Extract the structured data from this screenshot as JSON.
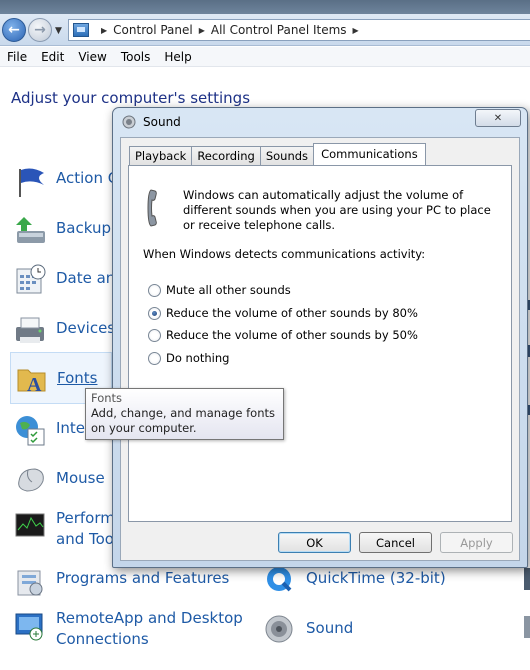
{
  "explorer": {
    "breadcrumb": [
      "Control Panel",
      "All Control Panel Items"
    ],
    "menu": [
      "File",
      "Edit",
      "View",
      "Tools",
      "Help"
    ],
    "heading": "Adjust your computer's settings",
    "items": [
      {
        "label": "Action C",
        "icon": "flag-icon"
      },
      {
        "label": "Backup a",
        "icon": "backup-icon"
      },
      {
        "label": "Date and",
        "icon": "calendar-clock-icon"
      },
      {
        "label": "Devices",
        "icon": "printer-icon"
      },
      {
        "label": "Fonts",
        "icon": "fonts-folder-icon"
      },
      {
        "label": "Inte",
        "icon": "globe-icon"
      },
      {
        "label": "Mouse",
        "icon": "mouse-icon"
      },
      {
        "label": "Perform",
        "label2": "and Too",
        "icon": "performance-icon"
      },
      {
        "label": "Programs and Features",
        "icon": "programs-icon"
      },
      {
        "label": "RemoteApp and Desktop",
        "label2": "Connections",
        "icon": "remoteapp-icon"
      }
    ],
    "right_items": [
      {
        "label": "QuickTime (32-bit)",
        "icon": "quicktime-icon"
      },
      {
        "label": "Sound",
        "icon": "speaker-icon"
      }
    ]
  },
  "tooltip": {
    "title": "Fonts",
    "text": "Add, change, and manage fonts on your computer."
  },
  "dialog": {
    "title": "Sound",
    "close": "✕",
    "tabs": [
      "Playback",
      "Recording",
      "Sounds",
      "Communications"
    ],
    "active_tab": "Communications",
    "description": "Windows can automatically adjust the volume of different sounds when you are using your PC to place or receive telephone calls.",
    "detect_label": "When Windows detects communications activity:",
    "options": [
      {
        "label": "Mute all other sounds",
        "checked": false
      },
      {
        "label": "Reduce the volume of other sounds by 80%",
        "checked": true
      },
      {
        "label": "Reduce the volume of other sounds by 50%",
        "checked": false
      },
      {
        "label": "Do nothing",
        "checked": false
      }
    ],
    "buttons": {
      "ok": "OK",
      "cancel": "Cancel",
      "apply": "Apply"
    }
  }
}
